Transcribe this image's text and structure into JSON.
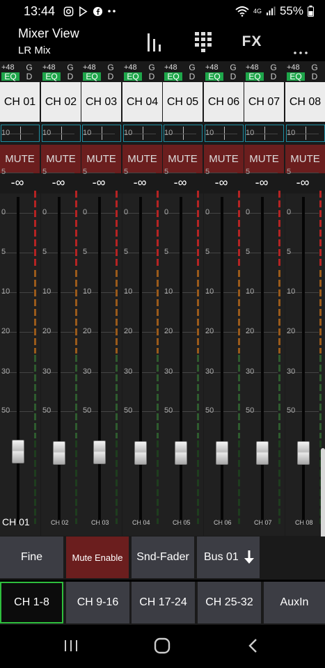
{
  "status": {
    "time": "13:44",
    "signal": "4G",
    "battery": "55%",
    "icons": [
      "instagram-icon",
      "play-store-icon",
      "facebook-icon",
      "more-dots-icon",
      "wifi-icon",
      "signal-icon",
      "battery-icon"
    ]
  },
  "header": {
    "title": "Mixer View",
    "subtitle": "LR Mix",
    "meters_button": "meters-icon",
    "grid_button": "grid-icon",
    "fx_label": "FX",
    "overflow_button": "more-vertical-icon"
  },
  "channel_flags": {
    "phantom": "+48",
    "eq": "EQ",
    "gate": "G",
    "dyn": "D"
  },
  "channels": [
    {
      "name": "CH 01",
      "mute": "MUTE",
      "level": "-∞",
      "footer": "CH 01"
    },
    {
      "name": "CH 02",
      "mute": "MUTE",
      "level": "-∞",
      "footer": "CH 02"
    },
    {
      "name": "CH 03",
      "mute": "MUTE",
      "level": "-∞",
      "footer": "CH 03"
    },
    {
      "name": "CH 04",
      "mute": "MUTE",
      "level": "-∞",
      "footer": "CH 04"
    },
    {
      "name": "CH 05",
      "mute": "MUTE",
      "level": "-∞",
      "footer": "CH 05"
    },
    {
      "name": "CH 06",
      "mute": "MUTE",
      "level": "-∞",
      "footer": "CH 06"
    },
    {
      "name": "CH 07",
      "mute": "MUTE",
      "level": "-∞",
      "footer": "CH 07"
    },
    {
      "name": "CH 08",
      "mute": "MUTE",
      "level": "-∞",
      "footer": "CH 08"
    }
  ],
  "fader_scale": [
    "10",
    "5",
    "0",
    "5",
    "10",
    "20",
    "30",
    "50"
  ],
  "controls": {
    "fine": "Fine",
    "mute_enable": "Mute Enable",
    "snd_fader": "Snd-Fader",
    "bus": "Bus 01"
  },
  "banks": {
    "items": [
      "CH 1-8",
      "CH 9-16",
      "CH 17-24",
      "CH 25-32",
      "AuxIn"
    ],
    "active": "CH 1-8"
  },
  "colors": {
    "mute": "#6b1e1e",
    "eq_active": "#1ea64a",
    "pan_border": "#1f8fa3",
    "bank_active_border": "#2ebf3d"
  }
}
